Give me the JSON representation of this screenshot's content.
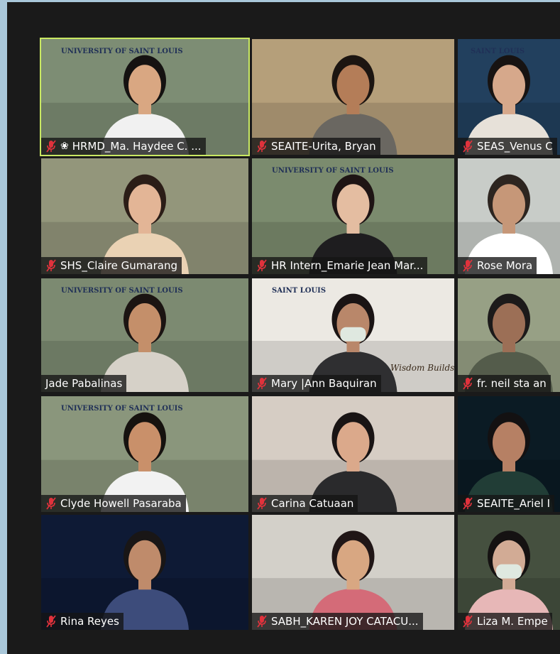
{
  "participants": [
    {
      "name": "HRMD_Ma. Haydee C. ...",
      "muted": true,
      "pinned": true,
      "active": true,
      "bg": "#7d8d74",
      "skin": "#d9a782",
      "shirt": "#f1f1f1",
      "hair": "#151211",
      "logo_text": "UNIVERSITY OF SAINT LOUIS"
    },
    {
      "name": "SEAITE-Urita, Bryan",
      "muted": true,
      "bg": "#b59f7a",
      "skin": "#b47d58",
      "shirt": "#6a6761",
      "hair": "#1c1511"
    },
    {
      "name": "SEAS_Venus C",
      "muted": true,
      "bg": "#22405e",
      "skin": "#d6a88b",
      "shirt": "#e7e1d9",
      "hair": "#171312",
      "logo_text": "SAINT LOUIS"
    },
    {
      "name": "SHS_Claire Gumarang",
      "muted": true,
      "bg": "#93967b",
      "skin": "#e3b596",
      "shirt": "#ead2b4",
      "hair": "#2b1d17"
    },
    {
      "name": "HR Intern_Emarie Jean Mar...",
      "muted": true,
      "bg": "#7b8b6e",
      "skin": "#e4bda1",
      "shirt": "#1e1d1f",
      "hair": "#1e1414",
      "logo_text": "UNIVERSITY OF SAINT LOUIS"
    },
    {
      "name": "Rose Mora",
      "muted": true,
      "bg": "#c8ccc8",
      "skin": "#c69778",
      "shirt": "#ffffff",
      "hair": "#2d2520"
    },
    {
      "name": "Jade Pabalinas",
      "muted": false,
      "bg": "#7c8a71",
      "skin": "#c48f6a",
      "shirt": "#d6d1c8",
      "hair": "#1b1412",
      "logo_text": "UNIVERSITY OF SAINT LOUIS"
    },
    {
      "name": "Mary |Ann Baquiran",
      "muted": true,
      "bg": "#ece9e3",
      "skin": "#b9876a",
      "shirt": "#2f2f31",
      "hair": "#1a1414",
      "logo_text": "SAINT LOUIS",
      "caption": "Wisdom Builds",
      "mask": true
    },
    {
      "name": "fr. neil sta an",
      "muted": true,
      "bg": "#97a085",
      "skin": "#9c6f56",
      "shirt": "#545c4b",
      "hair": "#1c1a1a"
    },
    {
      "name": "Clyde Howell Pasaraba",
      "muted": true,
      "bg": "#8a967c",
      "skin": "#c9906a",
      "shirt": "#f2f2f2",
      "hair": "#16120f",
      "logo_text": "UNIVERSITY OF SAINT LOUIS"
    },
    {
      "name": "Carina Catuaan",
      "muted": true,
      "bg": "#d6cdc4",
      "skin": "#dba98b",
      "shirt": "#2a2a2c",
      "hair": "#191414"
    },
    {
      "name": "SEAITE_Ariel I",
      "muted": true,
      "bg": "#0b1b24",
      "skin": "#b68064",
      "shirt": "#213d36",
      "hair": "#131112"
    },
    {
      "name": "Rina Reyes",
      "muted": true,
      "bg": "#0e1a35",
      "skin": "#bf8b6b",
      "shirt": "#3d4c7b",
      "hair": "#191616"
    },
    {
      "name": "SABH_KAREN JOY CATACU...",
      "muted": true,
      "bg": "#d3d0c9",
      "skin": "#d8a782",
      "shirt": "#d46b78",
      "hair": "#201616"
    },
    {
      "name": "Liza M. Empe",
      "muted": true,
      "bg": "#45503f",
      "skin": "#d2ab95",
      "shirt": "#e7b7b7",
      "hair": "#151212",
      "mask": true
    }
  ],
  "colors": {
    "active_border": "#c9e862",
    "muted_icon": "#e0323c",
    "tag_bg": "#141414"
  }
}
